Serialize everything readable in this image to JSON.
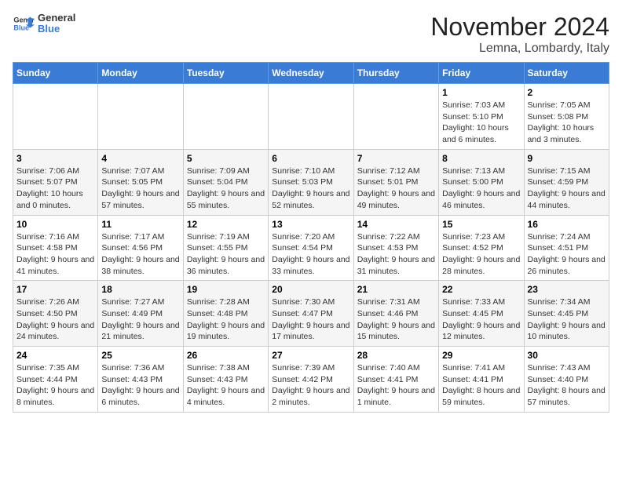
{
  "logo": {
    "text_general": "General",
    "text_blue": "Blue"
  },
  "title": "November 2024",
  "location": "Lemna, Lombardy, Italy",
  "weekdays": [
    "Sunday",
    "Monday",
    "Tuesday",
    "Wednesday",
    "Thursday",
    "Friday",
    "Saturday"
  ],
  "weeks": [
    {
      "days": [
        {
          "num": "",
          "info": ""
        },
        {
          "num": "",
          "info": ""
        },
        {
          "num": "",
          "info": ""
        },
        {
          "num": "",
          "info": ""
        },
        {
          "num": "",
          "info": ""
        },
        {
          "num": "1",
          "info": "Sunrise: 7:03 AM\nSunset: 5:10 PM\nDaylight: 10 hours and 6 minutes."
        },
        {
          "num": "2",
          "info": "Sunrise: 7:05 AM\nSunset: 5:08 PM\nDaylight: 10 hours and 3 minutes."
        }
      ]
    },
    {
      "days": [
        {
          "num": "3",
          "info": "Sunrise: 7:06 AM\nSunset: 5:07 PM\nDaylight: 10 hours and 0 minutes."
        },
        {
          "num": "4",
          "info": "Sunrise: 7:07 AM\nSunset: 5:05 PM\nDaylight: 9 hours and 57 minutes."
        },
        {
          "num": "5",
          "info": "Sunrise: 7:09 AM\nSunset: 5:04 PM\nDaylight: 9 hours and 55 minutes."
        },
        {
          "num": "6",
          "info": "Sunrise: 7:10 AM\nSunset: 5:03 PM\nDaylight: 9 hours and 52 minutes."
        },
        {
          "num": "7",
          "info": "Sunrise: 7:12 AM\nSunset: 5:01 PM\nDaylight: 9 hours and 49 minutes."
        },
        {
          "num": "8",
          "info": "Sunrise: 7:13 AM\nSunset: 5:00 PM\nDaylight: 9 hours and 46 minutes."
        },
        {
          "num": "9",
          "info": "Sunrise: 7:15 AM\nSunset: 4:59 PM\nDaylight: 9 hours and 44 minutes."
        }
      ]
    },
    {
      "days": [
        {
          "num": "10",
          "info": "Sunrise: 7:16 AM\nSunset: 4:58 PM\nDaylight: 9 hours and 41 minutes."
        },
        {
          "num": "11",
          "info": "Sunrise: 7:17 AM\nSunset: 4:56 PM\nDaylight: 9 hours and 38 minutes."
        },
        {
          "num": "12",
          "info": "Sunrise: 7:19 AM\nSunset: 4:55 PM\nDaylight: 9 hours and 36 minutes."
        },
        {
          "num": "13",
          "info": "Sunrise: 7:20 AM\nSunset: 4:54 PM\nDaylight: 9 hours and 33 minutes."
        },
        {
          "num": "14",
          "info": "Sunrise: 7:22 AM\nSunset: 4:53 PM\nDaylight: 9 hours and 31 minutes."
        },
        {
          "num": "15",
          "info": "Sunrise: 7:23 AM\nSunset: 4:52 PM\nDaylight: 9 hours and 28 minutes."
        },
        {
          "num": "16",
          "info": "Sunrise: 7:24 AM\nSunset: 4:51 PM\nDaylight: 9 hours and 26 minutes."
        }
      ]
    },
    {
      "days": [
        {
          "num": "17",
          "info": "Sunrise: 7:26 AM\nSunset: 4:50 PM\nDaylight: 9 hours and 24 minutes."
        },
        {
          "num": "18",
          "info": "Sunrise: 7:27 AM\nSunset: 4:49 PM\nDaylight: 9 hours and 21 minutes."
        },
        {
          "num": "19",
          "info": "Sunrise: 7:28 AM\nSunset: 4:48 PM\nDaylight: 9 hours and 19 minutes."
        },
        {
          "num": "20",
          "info": "Sunrise: 7:30 AM\nSunset: 4:47 PM\nDaylight: 9 hours and 17 minutes."
        },
        {
          "num": "21",
          "info": "Sunrise: 7:31 AM\nSunset: 4:46 PM\nDaylight: 9 hours and 15 minutes."
        },
        {
          "num": "22",
          "info": "Sunrise: 7:33 AM\nSunset: 4:45 PM\nDaylight: 9 hours and 12 minutes."
        },
        {
          "num": "23",
          "info": "Sunrise: 7:34 AM\nSunset: 4:45 PM\nDaylight: 9 hours and 10 minutes."
        }
      ]
    },
    {
      "days": [
        {
          "num": "24",
          "info": "Sunrise: 7:35 AM\nSunset: 4:44 PM\nDaylight: 9 hours and 8 minutes."
        },
        {
          "num": "25",
          "info": "Sunrise: 7:36 AM\nSunset: 4:43 PM\nDaylight: 9 hours and 6 minutes."
        },
        {
          "num": "26",
          "info": "Sunrise: 7:38 AM\nSunset: 4:43 PM\nDaylight: 9 hours and 4 minutes."
        },
        {
          "num": "27",
          "info": "Sunrise: 7:39 AM\nSunset: 4:42 PM\nDaylight: 9 hours and 2 minutes."
        },
        {
          "num": "28",
          "info": "Sunrise: 7:40 AM\nSunset: 4:41 PM\nDaylight: 9 hours and 1 minute."
        },
        {
          "num": "29",
          "info": "Sunrise: 7:41 AM\nSunset: 4:41 PM\nDaylight: 8 hours and 59 minutes."
        },
        {
          "num": "30",
          "info": "Sunrise: 7:43 AM\nSunset: 4:40 PM\nDaylight: 8 hours and 57 minutes."
        }
      ]
    }
  ]
}
